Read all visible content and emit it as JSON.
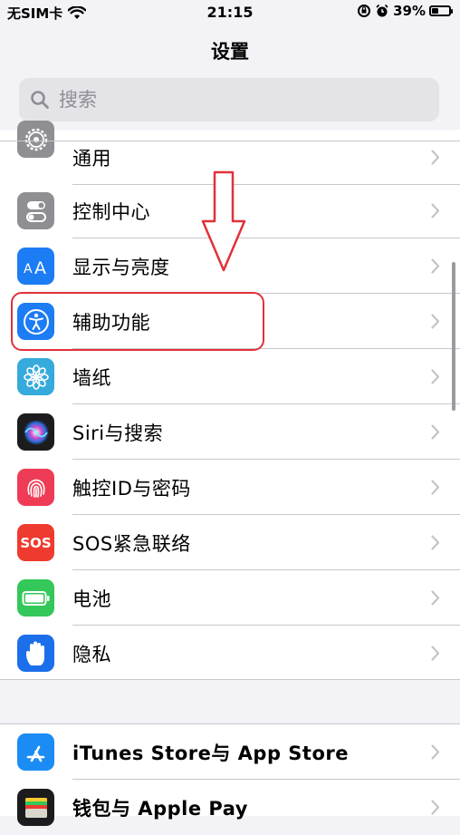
{
  "status_bar": {
    "carrier": "无SIM卡",
    "time": "21:15",
    "battery_percent": "39%",
    "battery_level": 0.39
  },
  "nav": {
    "title": "设置"
  },
  "search": {
    "placeholder": "搜索"
  },
  "settings_group_1": [
    {
      "label": "通用",
      "icon": "gear-icon",
      "color": "#8e8e93"
    },
    {
      "label": "控制中心",
      "icon": "toggle-icon",
      "color": "#8e8e93"
    },
    {
      "label": "显示与亮度",
      "icon": "text-size-icon",
      "color": "#1c7cf4"
    },
    {
      "label": "辅助功能",
      "icon": "accessibility-icon",
      "color": "#1c7cf4"
    },
    {
      "label": "墙纸",
      "icon": "flower-icon",
      "color": "#36aadc"
    },
    {
      "label": "Siri与搜索",
      "icon": "siri-icon",
      "color": "#1c1c1e"
    },
    {
      "label": "触控ID与密码",
      "icon": "fingerprint-icon",
      "color": "#ef3c56"
    },
    {
      "label": "SOS紧急联络",
      "icon": "sos-icon",
      "color": "#ef3b2f",
      "badge": "SOS"
    },
    {
      "label": "电池",
      "icon": "battery-icon",
      "color": "#34c759"
    },
    {
      "label": "隐私",
      "icon": "hand-icon",
      "color": "#1c6fea"
    }
  ],
  "settings_group_2": [
    {
      "label": "iTunes Store与 App Store",
      "icon": "app-store-icon",
      "color": "#1c8cf5"
    },
    {
      "label": "钱包与 Apple Pay",
      "icon": "wallet-icon",
      "color": "#1c1c1e"
    }
  ],
  "colors": {
    "annotation_red": "#e0313a",
    "chevron": "#c4c4c7"
  }
}
